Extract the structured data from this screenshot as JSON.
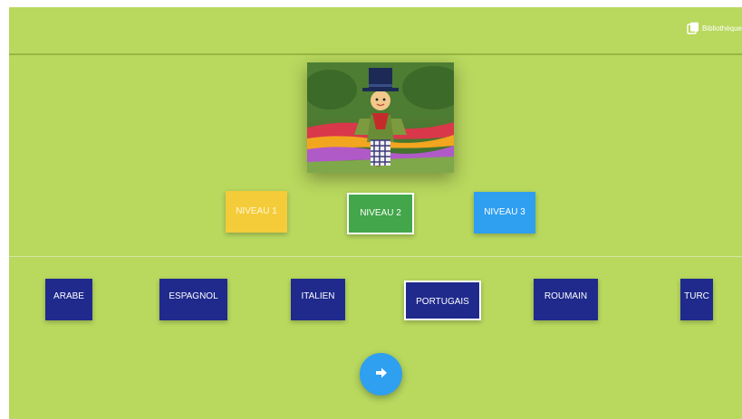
{
  "header": {
    "library_label": "Bibliothèque",
    "library_icon": "library-icon"
  },
  "illustration": {
    "description_icon": "scarecrow-garden-image"
  },
  "levels": [
    {
      "label": "NIVEAU 1",
      "color": "#f4cc3a",
      "selected": false
    },
    {
      "label": "NIVEAU 2",
      "color": "#43a64a",
      "selected": true
    },
    {
      "label": "NIVEAU 3",
      "color": "#2f9ff0",
      "selected": false
    }
  ],
  "languages": [
    {
      "label": "ARABE",
      "selected": false
    },
    {
      "label": "ESPAGNOL",
      "selected": false
    },
    {
      "label": "ITALIEN",
      "selected": false
    },
    {
      "label": "PORTUGAIS",
      "selected": true
    },
    {
      "label": "ROUMAIN",
      "selected": false
    },
    {
      "label": "TURC",
      "selected": false
    }
  ],
  "next_button": {
    "icon": "arrow-right-icon"
  },
  "colors": {
    "background": "#b8d85e",
    "language_button": "#1f2a8c",
    "accent_blue": "#2f9ff0"
  }
}
